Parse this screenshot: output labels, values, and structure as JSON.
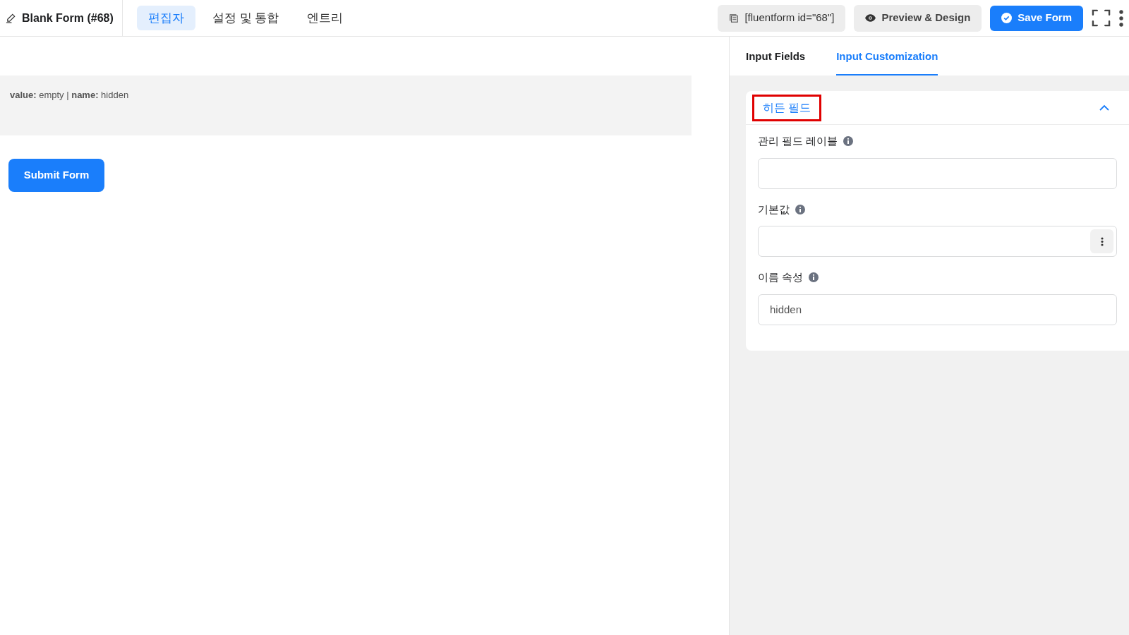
{
  "header": {
    "form_title": "Blank Form (#68)",
    "tabs": [
      {
        "label": "편집자",
        "selected": true
      },
      {
        "label": "설정 및 통합",
        "selected": false
      },
      {
        "label": "엔트리",
        "selected": false
      }
    ],
    "shortcode": "[fluentform id=\"68\"]",
    "preview_button": "Preview & Design",
    "save_button": "Save Form"
  },
  "canvas": {
    "hidden_field_summary": "**value:** empty | **name:** hidden",
    "submit_button": "Submit Form"
  },
  "panel": {
    "tabs": [
      {
        "label": "Input Fields",
        "selected": false
      },
      {
        "label": "Input Customization",
        "selected": true
      }
    ],
    "section": {
      "title": "히든 필드",
      "highlighted": true,
      "expanded": true,
      "fields": [
        {
          "kind": "text",
          "label": "관리 필드 레이블"
        },
        {
          "kind": "text-with-menu",
          "label": "기본값"
        },
        {
          "kind": "text",
          "label": "이름 속성",
          "value": "hidden"
        }
      ]
    }
  }
}
